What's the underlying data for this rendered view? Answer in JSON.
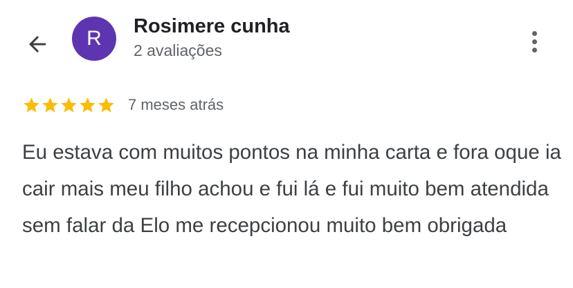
{
  "header": {
    "back_icon": "arrow-left-icon",
    "avatar": {
      "initial": "R",
      "color": "#5e35b1"
    },
    "user_name": "Rosimere cunha",
    "user_reviews": "2 avaliações",
    "more_icon": "more-vertical-icon"
  },
  "review": {
    "rating": 5,
    "max_rating": 5,
    "star_color": "#fbbc04",
    "date": "7 meses atrás",
    "text": "Eu estava com muitos pontos na minha carta e fora oque ia cair mais meu filho achou e fui lá e fui muito bem atendida sem falar da Elo me recepcionou muito bem obrigada"
  }
}
